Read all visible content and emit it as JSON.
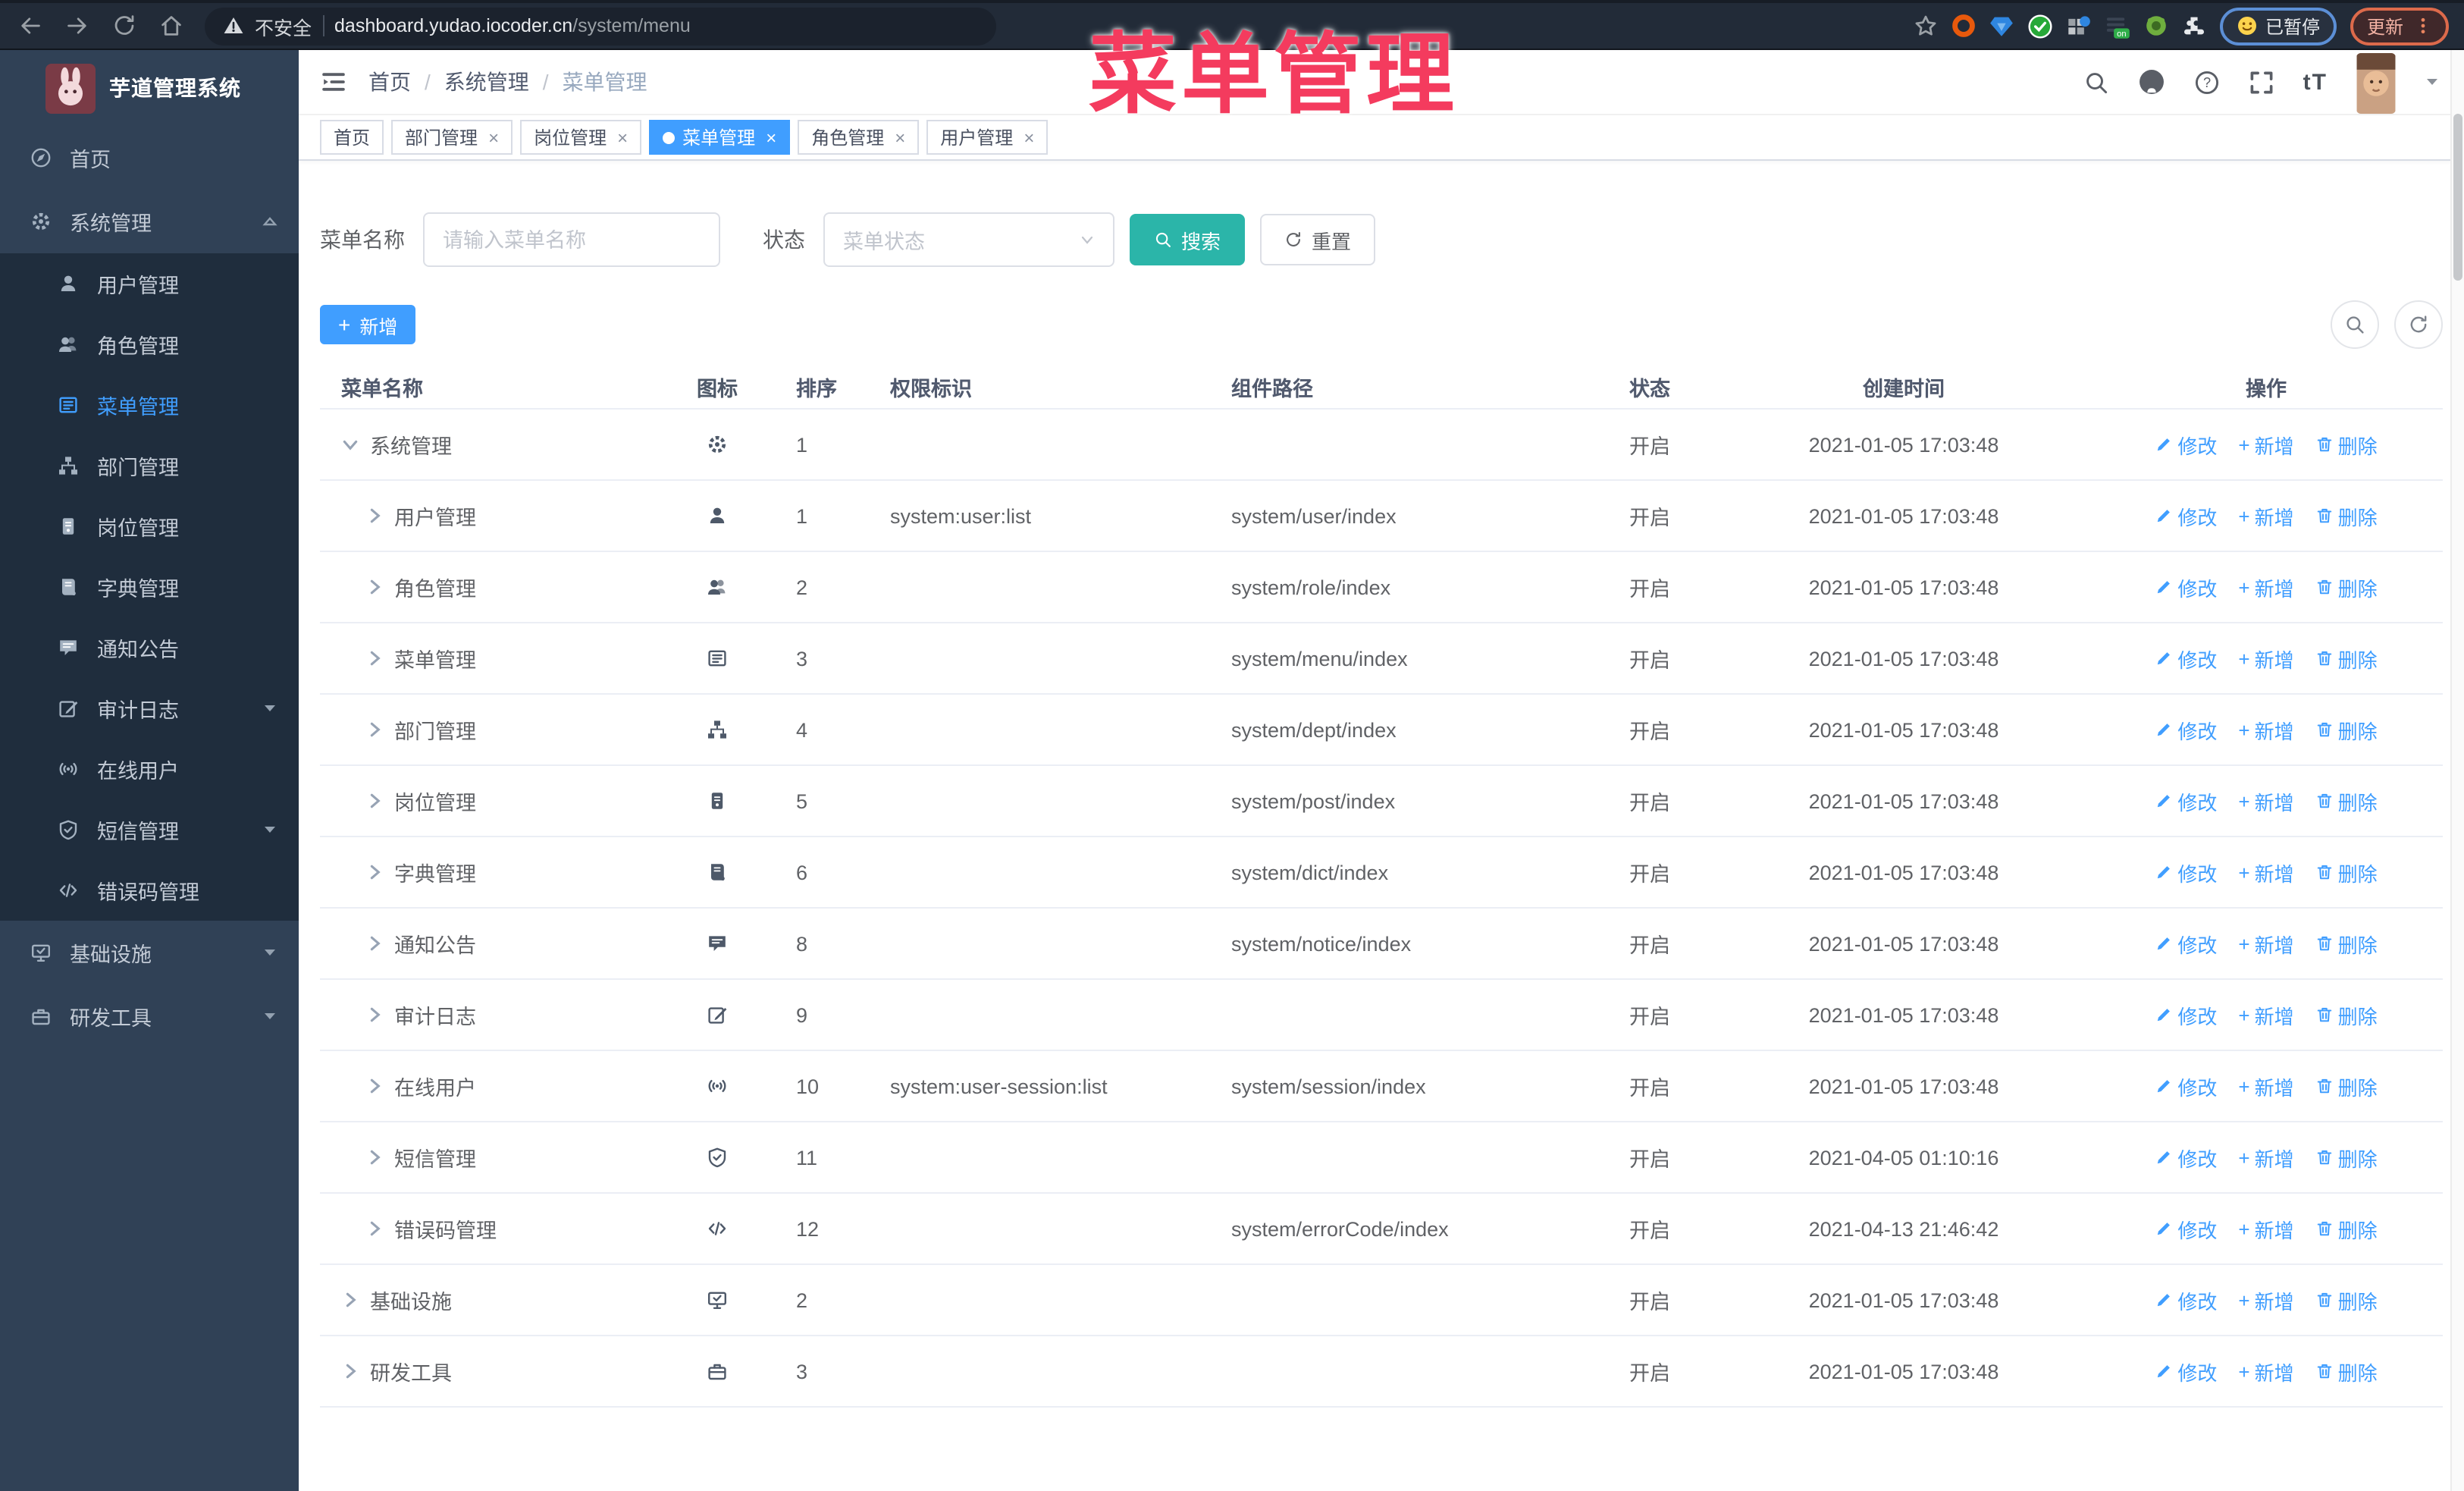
{
  "colors": {
    "accent_blue": "#409eff",
    "teal": "#2bb5a9",
    "watermark_pink": "#f43b5e",
    "sidebar_bg": "#304156",
    "sidebar_sub_bg": "#1f2d3d",
    "browser_bar": "#222b38"
  },
  "watermark": "菜单管理",
  "browser": {
    "security_label": "不安全",
    "url_host": "dashboard.yudao.iocoder.cn",
    "url_path": "/system/menu",
    "paused_badge": "已暂停",
    "update_button": "更新",
    "nav_icons": [
      "back",
      "forward",
      "reload",
      "home"
    ],
    "extension_icons": [
      "bookmark-star",
      "orange-ring",
      "blue-gem",
      "green-check",
      "grid",
      "proxy-on",
      "monkey",
      "puzzle"
    ]
  },
  "sidebar": {
    "app_title": "芋道管理系统",
    "items": [
      {
        "label": "首页",
        "icon": "guide",
        "type": "root"
      },
      {
        "label": "系统管理",
        "icon": "gear",
        "type": "root",
        "caret": "up"
      },
      {
        "label": "用户管理",
        "icon": "user",
        "type": "sub"
      },
      {
        "label": "角色管理",
        "icon": "users",
        "type": "sub"
      },
      {
        "label": "菜单管理",
        "icon": "menu",
        "type": "sub",
        "active": true
      },
      {
        "label": "部门管理",
        "icon": "tree",
        "type": "sub"
      },
      {
        "label": "岗位管理",
        "icon": "badge",
        "type": "sub"
      },
      {
        "label": "字典管理",
        "icon": "book",
        "type": "sub"
      },
      {
        "label": "通知公告",
        "icon": "message",
        "type": "sub"
      },
      {
        "label": "审计日志",
        "icon": "edit",
        "type": "sub",
        "caret": "down"
      },
      {
        "label": "在线用户",
        "icon": "online",
        "type": "sub"
      },
      {
        "label": "短信管理",
        "icon": "shield",
        "type": "sub",
        "caret": "down"
      },
      {
        "label": "错误码管理",
        "icon": "code",
        "type": "sub"
      },
      {
        "label": "基础设施",
        "icon": "monitor",
        "type": "root",
        "caret": "down"
      },
      {
        "label": "研发工具",
        "icon": "tool",
        "type": "root",
        "caret": "down"
      }
    ]
  },
  "header": {
    "breadcrumb": [
      "首页",
      "系统管理",
      "菜单管理"
    ],
    "right_icons": [
      "search",
      "github",
      "help",
      "fullscreen",
      "fontsize",
      "avatar",
      "caret-down"
    ],
    "fontsize_label": "tT"
  },
  "tabs": [
    {
      "label": "首页",
      "closable": false,
      "active": false
    },
    {
      "label": "部门管理",
      "closable": true,
      "active": false
    },
    {
      "label": "岗位管理",
      "closable": true,
      "active": false
    },
    {
      "label": "菜单管理",
      "closable": true,
      "active": true
    },
    {
      "label": "角色管理",
      "closable": true,
      "active": false
    },
    {
      "label": "用户管理",
      "closable": true,
      "active": false
    }
  ],
  "filters": {
    "name_label": "菜单名称",
    "name_placeholder": "请输入菜单名称",
    "status_label": "状态",
    "status_placeholder": "菜单状态",
    "search_label": "搜索",
    "reset_label": "重置"
  },
  "toolbar": {
    "add_label": "新增"
  },
  "table": {
    "columns": [
      "菜单名称",
      "图标",
      "排序",
      "权限标识",
      "组件路径",
      "状态",
      "创建时间",
      "操作"
    ],
    "ops": [
      "修改",
      "新增",
      "删除"
    ],
    "rows": [
      {
        "name": "系统管理",
        "expand": "open",
        "level": 0,
        "icon": "gear",
        "sort": "1",
        "perm": "",
        "path": "",
        "status": "开启",
        "time": "2021-01-05 17:03:48"
      },
      {
        "name": "用户管理",
        "expand": "closed",
        "level": 1,
        "icon": "user",
        "sort": "1",
        "perm": "system:user:list",
        "path": "system/user/index",
        "status": "开启",
        "time": "2021-01-05 17:03:48"
      },
      {
        "name": "角色管理",
        "expand": "closed",
        "level": 1,
        "icon": "users",
        "sort": "2",
        "perm": "",
        "path": "system/role/index",
        "status": "开启",
        "time": "2021-01-05 17:03:48"
      },
      {
        "name": "菜单管理",
        "expand": "closed",
        "level": 1,
        "icon": "menu",
        "sort": "3",
        "perm": "",
        "path": "system/menu/index",
        "status": "开启",
        "time": "2021-01-05 17:03:48"
      },
      {
        "name": "部门管理",
        "expand": "closed",
        "level": 1,
        "icon": "tree",
        "sort": "4",
        "perm": "",
        "path": "system/dept/index",
        "status": "开启",
        "time": "2021-01-05 17:03:48"
      },
      {
        "name": "岗位管理",
        "expand": "closed",
        "level": 1,
        "icon": "badge",
        "sort": "5",
        "perm": "",
        "path": "system/post/index",
        "status": "开启",
        "time": "2021-01-05 17:03:48"
      },
      {
        "name": "字典管理",
        "expand": "closed",
        "level": 1,
        "icon": "book",
        "sort": "6",
        "perm": "",
        "path": "system/dict/index",
        "status": "开启",
        "time": "2021-01-05 17:03:48"
      },
      {
        "name": "通知公告",
        "expand": "closed",
        "level": 1,
        "icon": "message",
        "sort": "8",
        "perm": "",
        "path": "system/notice/index",
        "status": "开启",
        "time": "2021-01-05 17:03:48"
      },
      {
        "name": "审计日志",
        "expand": "closed",
        "level": 1,
        "icon": "edit",
        "sort": "9",
        "perm": "",
        "path": "",
        "status": "开启",
        "time": "2021-01-05 17:03:48"
      },
      {
        "name": "在线用户",
        "expand": "closed",
        "level": 1,
        "icon": "online",
        "sort": "10",
        "perm": "system:user-session:list",
        "path": "system/session/index",
        "status": "开启",
        "time": "2021-01-05 17:03:48"
      },
      {
        "name": "短信管理",
        "expand": "closed",
        "level": 1,
        "icon": "shield",
        "sort": "11",
        "perm": "",
        "path": "",
        "status": "开启",
        "time": "2021-04-05 01:10:16"
      },
      {
        "name": "错误码管理",
        "expand": "closed",
        "level": 1,
        "icon": "code",
        "sort": "12",
        "perm": "",
        "path": "system/errorCode/index",
        "status": "开启",
        "time": "2021-04-13 21:46:42"
      },
      {
        "name": "基础设施",
        "expand": "closed",
        "level": 0,
        "icon": "monitor",
        "sort": "2",
        "perm": "",
        "path": "",
        "status": "开启",
        "time": "2021-01-05 17:03:48"
      },
      {
        "name": "研发工具",
        "expand": "closed",
        "level": 0,
        "icon": "tool",
        "sort": "3",
        "perm": "",
        "path": "",
        "status": "开启",
        "time": "2021-01-05 17:03:48"
      }
    ]
  }
}
